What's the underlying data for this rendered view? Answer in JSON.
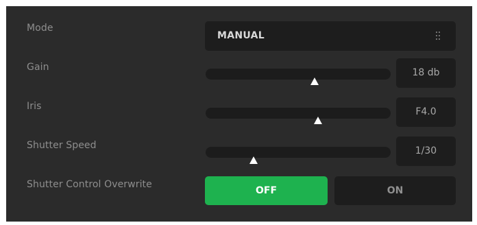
{
  "colors": {
    "panel_bg": "#2b2b2b",
    "control_bg": "#1d1d1d",
    "label_text": "#8e8e8e",
    "active_green": "#1eb24f",
    "thumb": "#ffffff"
  },
  "mode": {
    "label": "Mode",
    "value": "MANUAL",
    "icon": "grip-dots-icon"
  },
  "gain": {
    "label": "Gain",
    "value": "18 db",
    "level": 0.59
  },
  "iris": {
    "label": "Iris",
    "value": "F4.0",
    "level": 0.61
  },
  "shutter_speed": {
    "label": "Shutter Speed",
    "value": "1/30",
    "level": 0.26
  },
  "shutter_overwrite": {
    "label": "Shutter Control Overwrite",
    "off_label": "OFF",
    "on_label": "ON",
    "selected": "OFF"
  }
}
